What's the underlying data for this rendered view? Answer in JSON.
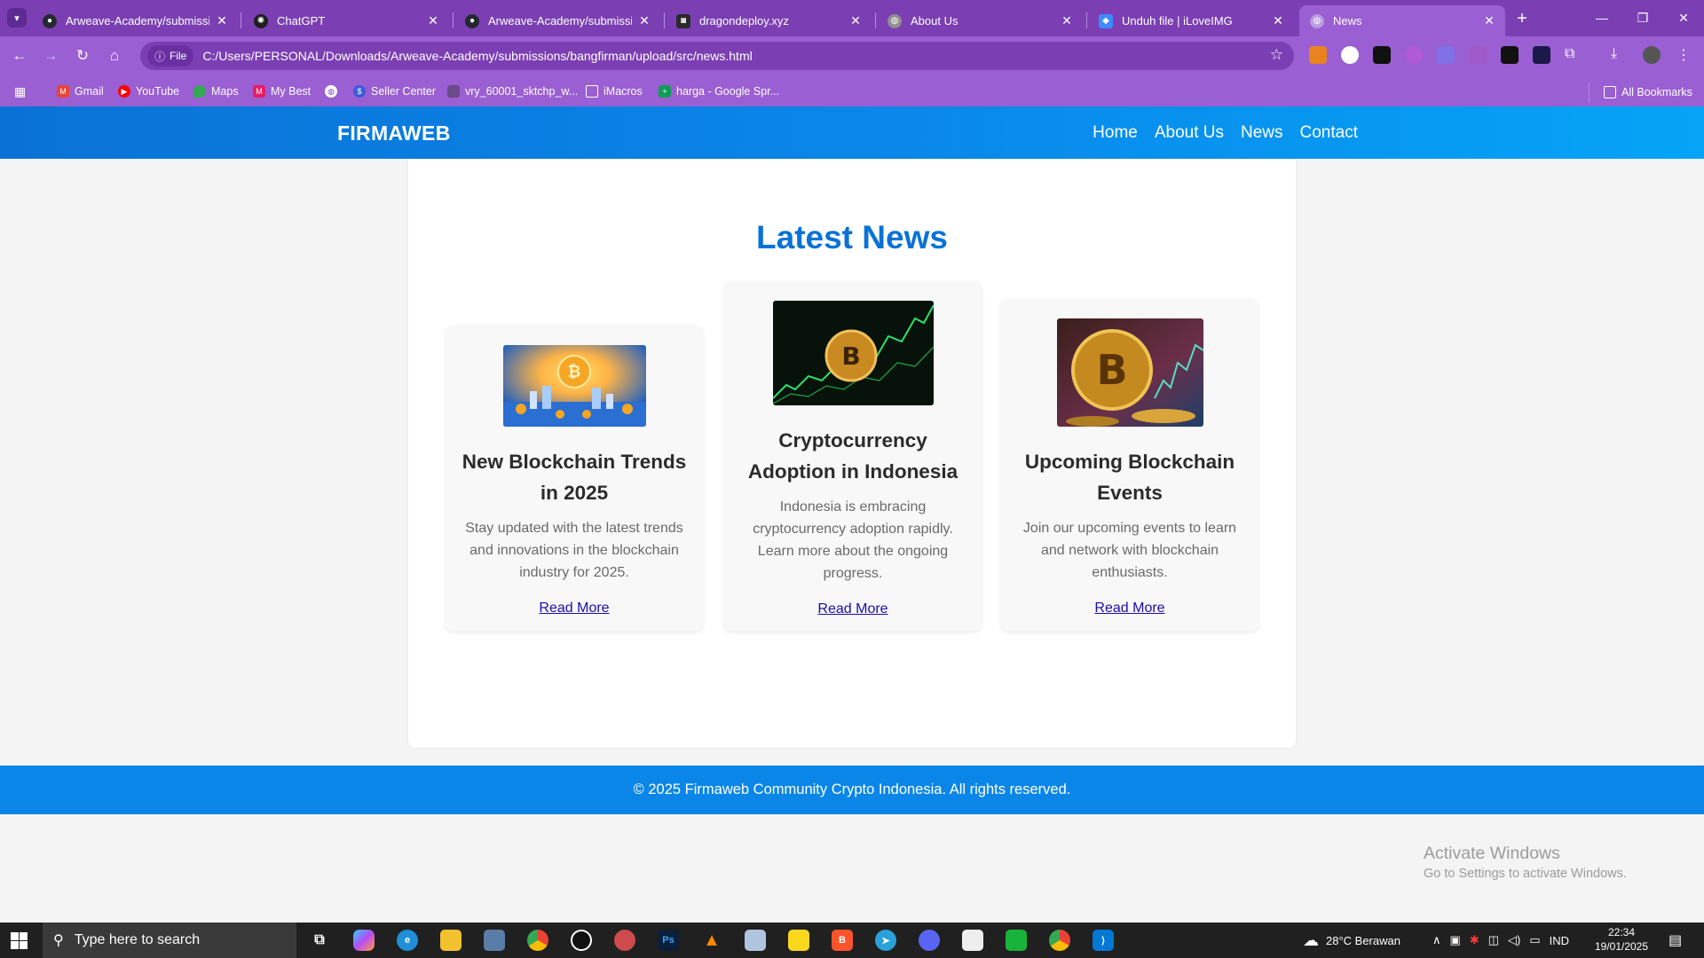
{
  "browser": {
    "tabs": [
      {
        "title": "Arweave-Academy/submissions",
        "icon": "github-icon"
      },
      {
        "title": "ChatGPT",
        "icon": "chatgpt-icon"
      },
      {
        "title": "Arweave-Academy/submissions",
        "icon": "github-icon"
      },
      {
        "title": "dragondeploy.xyz",
        "icon": "site-icon"
      },
      {
        "title": "About Us",
        "icon": "globe-icon"
      },
      {
        "title": "Unduh file | iLoveIMG",
        "icon": "iloveimg-icon"
      },
      {
        "title": "News",
        "icon": "globe-icon"
      }
    ],
    "address": {
      "chip": "File",
      "url": "C:/Users/PERSONAL/Downloads/Arweave-Academy/submissions/bangfirman/upload/src/news.html"
    },
    "bookmarks": [
      {
        "label": "Gmail",
        "color": "#ea4335"
      },
      {
        "label": "YouTube",
        "color": "#ff0000"
      },
      {
        "label": "Maps",
        "color": "#34a853"
      },
      {
        "label": "My Best",
        "color": "#e91e63"
      },
      {
        "label": "",
        "color": "#ffffff"
      },
      {
        "label": "Seller Center",
        "color": "#3b5bdb"
      },
      {
        "label": "vry_60001_sktchp_w...",
        "color": "#6a4a8a"
      },
      {
        "label": "iMacros",
        "color": "#ffffff"
      },
      {
        "label": "harga - Google Spr...",
        "color": "#0f9d58"
      }
    ],
    "all_bookmarks": "All Bookmarks"
  },
  "site": {
    "logo": "FIRMAWEB",
    "nav": [
      "Home",
      "About Us",
      "News",
      "Contact"
    ],
    "section_title": "Latest News",
    "cards": [
      {
        "title": "New Blockchain Trends in 2025",
        "description": "Stay updated with the latest trends and innovations in the blockchain industry for 2025.",
        "link": "Read More"
      },
      {
        "title": "Cryptocurrency Adoption in Indonesia",
        "description": "Indonesia is embracing cryptocurrency adoption rapidly. Learn more about the ongoing progress.",
        "link": "Read More"
      },
      {
        "title": "Upcoming Blockchain Events",
        "description": "Join our upcoming events to learn and network with blockchain enthusiasts.",
        "link": "Read More"
      }
    ],
    "footer": "© 2025 Firmaweb Community Crypto Indonesia. All rights reserved.",
    "accent": "#0a72d6"
  },
  "windows": {
    "activate_title": "Activate Windows",
    "activate_sub": "Go to Settings to activate Windows.",
    "search_placeholder": "Type here to search",
    "weather": "28°C  Berawan",
    "language": "IND",
    "time": "22:34",
    "date": "19/01/2025"
  }
}
